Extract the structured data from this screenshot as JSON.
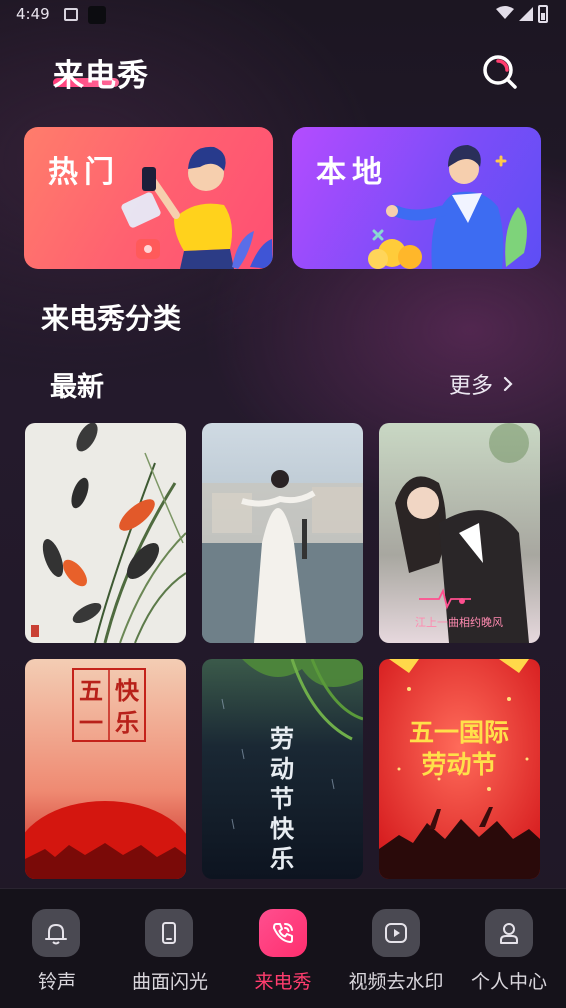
{
  "status_bar": {
    "time": "4:49"
  },
  "header": {
    "title": "来电秀",
    "search_icon": "search-icon"
  },
  "cards": [
    {
      "label": "热门",
      "colors": [
        "#ff7d6b",
        "#ff4f73"
      ]
    },
    {
      "label": "本地",
      "colors": [
        "#b44cff",
        "#5d4ef5"
      ]
    }
  ],
  "sections": {
    "category_title": "来电秀分类",
    "latest_title": "最新",
    "more_label": "更多"
  },
  "thumbnails": [
    {
      "caption": ""
    },
    {
      "caption": ""
    },
    {
      "caption": "江上一曲相约晚风"
    },
    {
      "caption_a": "五",
      "caption_b": "一",
      "caption_c": "快",
      "caption_d": "乐"
    },
    {
      "lines": [
        "劳",
        "动",
        "节",
        "快",
        "乐"
      ]
    },
    {
      "line1": "五一国际",
      "line2": "劳动节"
    }
  ],
  "nav": {
    "items": [
      {
        "label": "铃声",
        "icon": "bell-icon"
      },
      {
        "label": "曲面闪光",
        "icon": "phone-icon"
      },
      {
        "label": "来电秀",
        "icon": "phone-call-icon",
        "active": true
      },
      {
        "label": "视频去水印",
        "icon": "play-icon"
      },
      {
        "label": "个人中心",
        "icon": "user-icon"
      }
    ],
    "active_color": "#ff3d6e"
  }
}
